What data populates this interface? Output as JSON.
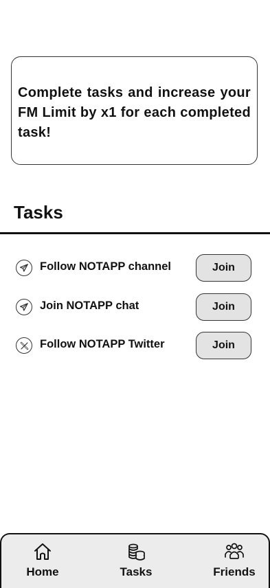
{
  "info_card": {
    "text": "Complete tasks and increase your FM Limit by x1 for each completed task!"
  },
  "tasks_section": {
    "title": "Tasks"
  },
  "tasks": [
    {
      "icon": "telegram-icon",
      "label": "Follow NOTAPP channel",
      "button_label": "Join"
    },
    {
      "icon": "telegram-icon",
      "label": "Join NOTAPP chat",
      "button_label": "Join"
    },
    {
      "icon": "x-twitter-icon",
      "label": "Follow NOTAPP Twitter",
      "button_label": "Join"
    }
  ],
  "bottom_nav": {
    "items": [
      {
        "icon": "home-icon",
        "label": "Home"
      },
      {
        "icon": "coins-icon",
        "label": "Tasks"
      },
      {
        "icon": "friends-icon",
        "label": "Friends"
      }
    ]
  },
  "colors": {
    "text": "#111111",
    "button_bg": "#e3e3e3",
    "nav_bg": "#ececec",
    "border": "#333333"
  }
}
